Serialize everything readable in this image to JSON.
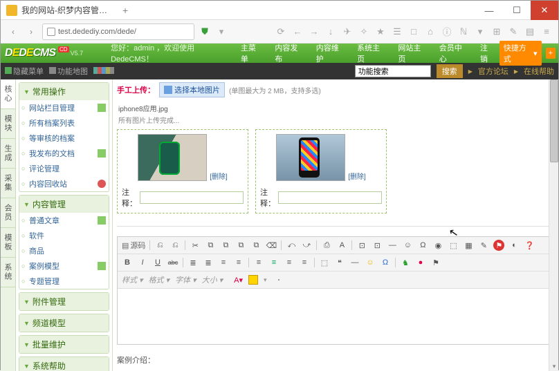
{
  "window": {
    "tab_title": "我的网站-织梦内容管理系...",
    "plus": "+",
    "min": "—",
    "max": "☐",
    "close": "✕"
  },
  "url": {
    "text": "test.dedediy.com/dede/",
    "nav_back": "‹",
    "nav_fwd": "›"
  },
  "toolbar_icons": [
    "⟳",
    "←",
    "→",
    "↓",
    "✈",
    "✧",
    "★",
    "☰",
    "□",
    "⌂",
    "ⓘ",
    "ℕ",
    "▾",
    "⊞",
    "✎",
    "▤",
    "≡"
  ],
  "cms": {
    "logo": "DEDECMS",
    "ver_badge": "CD",
    "ver": "V5.7",
    "welcome": "您好：admin ，欢迎使用DedeCMS！",
    "menu": [
      "主菜单",
      "内容发布",
      "内容维护",
      "系统主页",
      "网站主页",
      "会员中心",
      "注销"
    ],
    "quick": "快捷方式",
    "quick_plus": "+"
  },
  "sub": {
    "hide_menu": "隐藏菜单",
    "map": "功能地图",
    "search_value": "功能搜索",
    "search_btn": "搜索",
    "forum": "官方论坛",
    "help": "在线帮助"
  },
  "vtabs": [
    "核心",
    "模块",
    "生成",
    "采集",
    "会员",
    "模板",
    "系统"
  ],
  "sidebar": {
    "g1": {
      "title": "常用操作",
      "items": [
        "网站栏目管理",
        "所有档案列表",
        "等审核的档案",
        "我发布的文档",
        "评论管理",
        "内容回收站"
      ]
    },
    "g2": {
      "title": "内容管理",
      "items": [
        "普通文章",
        "软件",
        "商品",
        "案例模型",
        "专题管理"
      ]
    },
    "g3": {
      "title": "附件管理"
    },
    "g4": {
      "title": "频道模型"
    },
    "g5": {
      "title": "批量维护"
    },
    "g6": {
      "title": "系统帮助"
    }
  },
  "content": {
    "upload_label": "手工上传：",
    "upload_btn": "选择本地图片",
    "upload_hint": "(单图最大为 2 MB，支持多选)",
    "file_name": "iphone8应用.jpg",
    "file_status": "所有图片上传完成...",
    "delete": "[删除]",
    "anno_label": "注释：",
    "case_label": "案例介绍："
  },
  "editor": {
    "src": "源码",
    "row1": [
      "⎌",
      "⎌",
      "✂",
      "⧉",
      "⧉",
      "⧉",
      "⧉",
      "⌫",
      "⤺",
      "⤻",
      "⎙",
      "A",
      "⊡",
      "⊡",
      "—",
      "☺",
      "Ω",
      "◉",
      "⬚",
      "▦",
      "✎",
      "⚑",
      "◐",
      "❓"
    ],
    "row2_bold": "B",
    "row2_italic": "I",
    "row2_under": "U",
    "row2_abc": "abc",
    "row2_icons": [
      "≣",
      "≣",
      "≡",
      "≡",
      "≡",
      "≡",
      "≡",
      "≡",
      "⬚",
      "❝",
      "—",
      "☺",
      "Ω",
      "♞",
      "●",
      "⚑"
    ],
    "dd": [
      "样式",
      "格式",
      "字体",
      "大小"
    ],
    "chev": "▾"
  }
}
